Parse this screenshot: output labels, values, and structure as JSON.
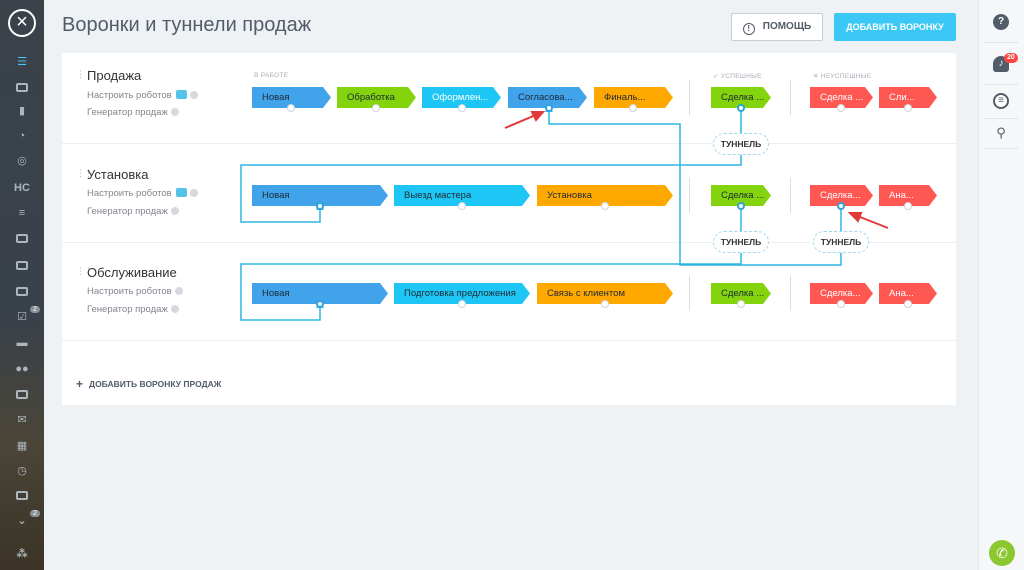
{
  "title": "Воронки и туннели продаж",
  "header": {
    "help_label": "ПОМОЩЬ",
    "add_funnel_label": "ДОБАВИТЬ ВОРОНКУ"
  },
  "groups": {
    "in_work": "В РАБОТЕ",
    "successful": "УСПЕШНЫЕ",
    "failed": "НЕУСПЕШНЫЕ"
  },
  "funnels": [
    {
      "name": "Продажа",
      "robots_link": "Настроить роботов",
      "generator_link": "Генератор продаж",
      "stages": [
        "Новая",
        "Обработка",
        "Оформлен...",
        "Согласова...",
        "Финаль..."
      ],
      "success": "Сделка ...",
      "failed": [
        "Сделка ...",
        "Сли..."
      ]
    },
    {
      "name": "Установка",
      "robots_link": "Настроить роботов",
      "generator_link": "Генератор продаж",
      "stages": [
        "Новая",
        "Выезд мастера",
        "Установка"
      ],
      "success": "Сделка ...",
      "failed": [
        "Сделка...",
        "Ана..."
      ]
    },
    {
      "name": "Обслуживание",
      "robots_link": "Настроить роботов",
      "generator_link": "Генератор продаж",
      "stages": [
        "Новая",
        "Подготовка предложения",
        "Связь с клиентом"
      ],
      "success": "Сделка ...",
      "failed": [
        "Сделка...",
        "Ана..."
      ]
    }
  ],
  "tunnel_label": "ТУННЕЛЬ",
  "add_sales_funnel_label": "ДОБАВИТЬ ВОРОНКУ ПРОДАЖ",
  "notifications_count": "20",
  "sidebar_badges": [
    "2",
    "2"
  ],
  "sidebar_text_icon": "НС",
  "colors": {
    "blue": "#41a3ea",
    "green": "#83d30d",
    "cyan": "#1ec6f5",
    "orange": "#ffa900",
    "red": "#ff5752",
    "tunnel_line": "#2fb5e2",
    "accent": "#3bc8f5"
  },
  "icons": [
    "close-icon",
    "filter-icon",
    "help-icon",
    "robot-icon",
    "question-icon",
    "bell-icon",
    "chat-icon",
    "search-icon",
    "phone-icon",
    "plus-icon",
    "check-icon",
    "cross-icon",
    "drag-handle-icon"
  ]
}
